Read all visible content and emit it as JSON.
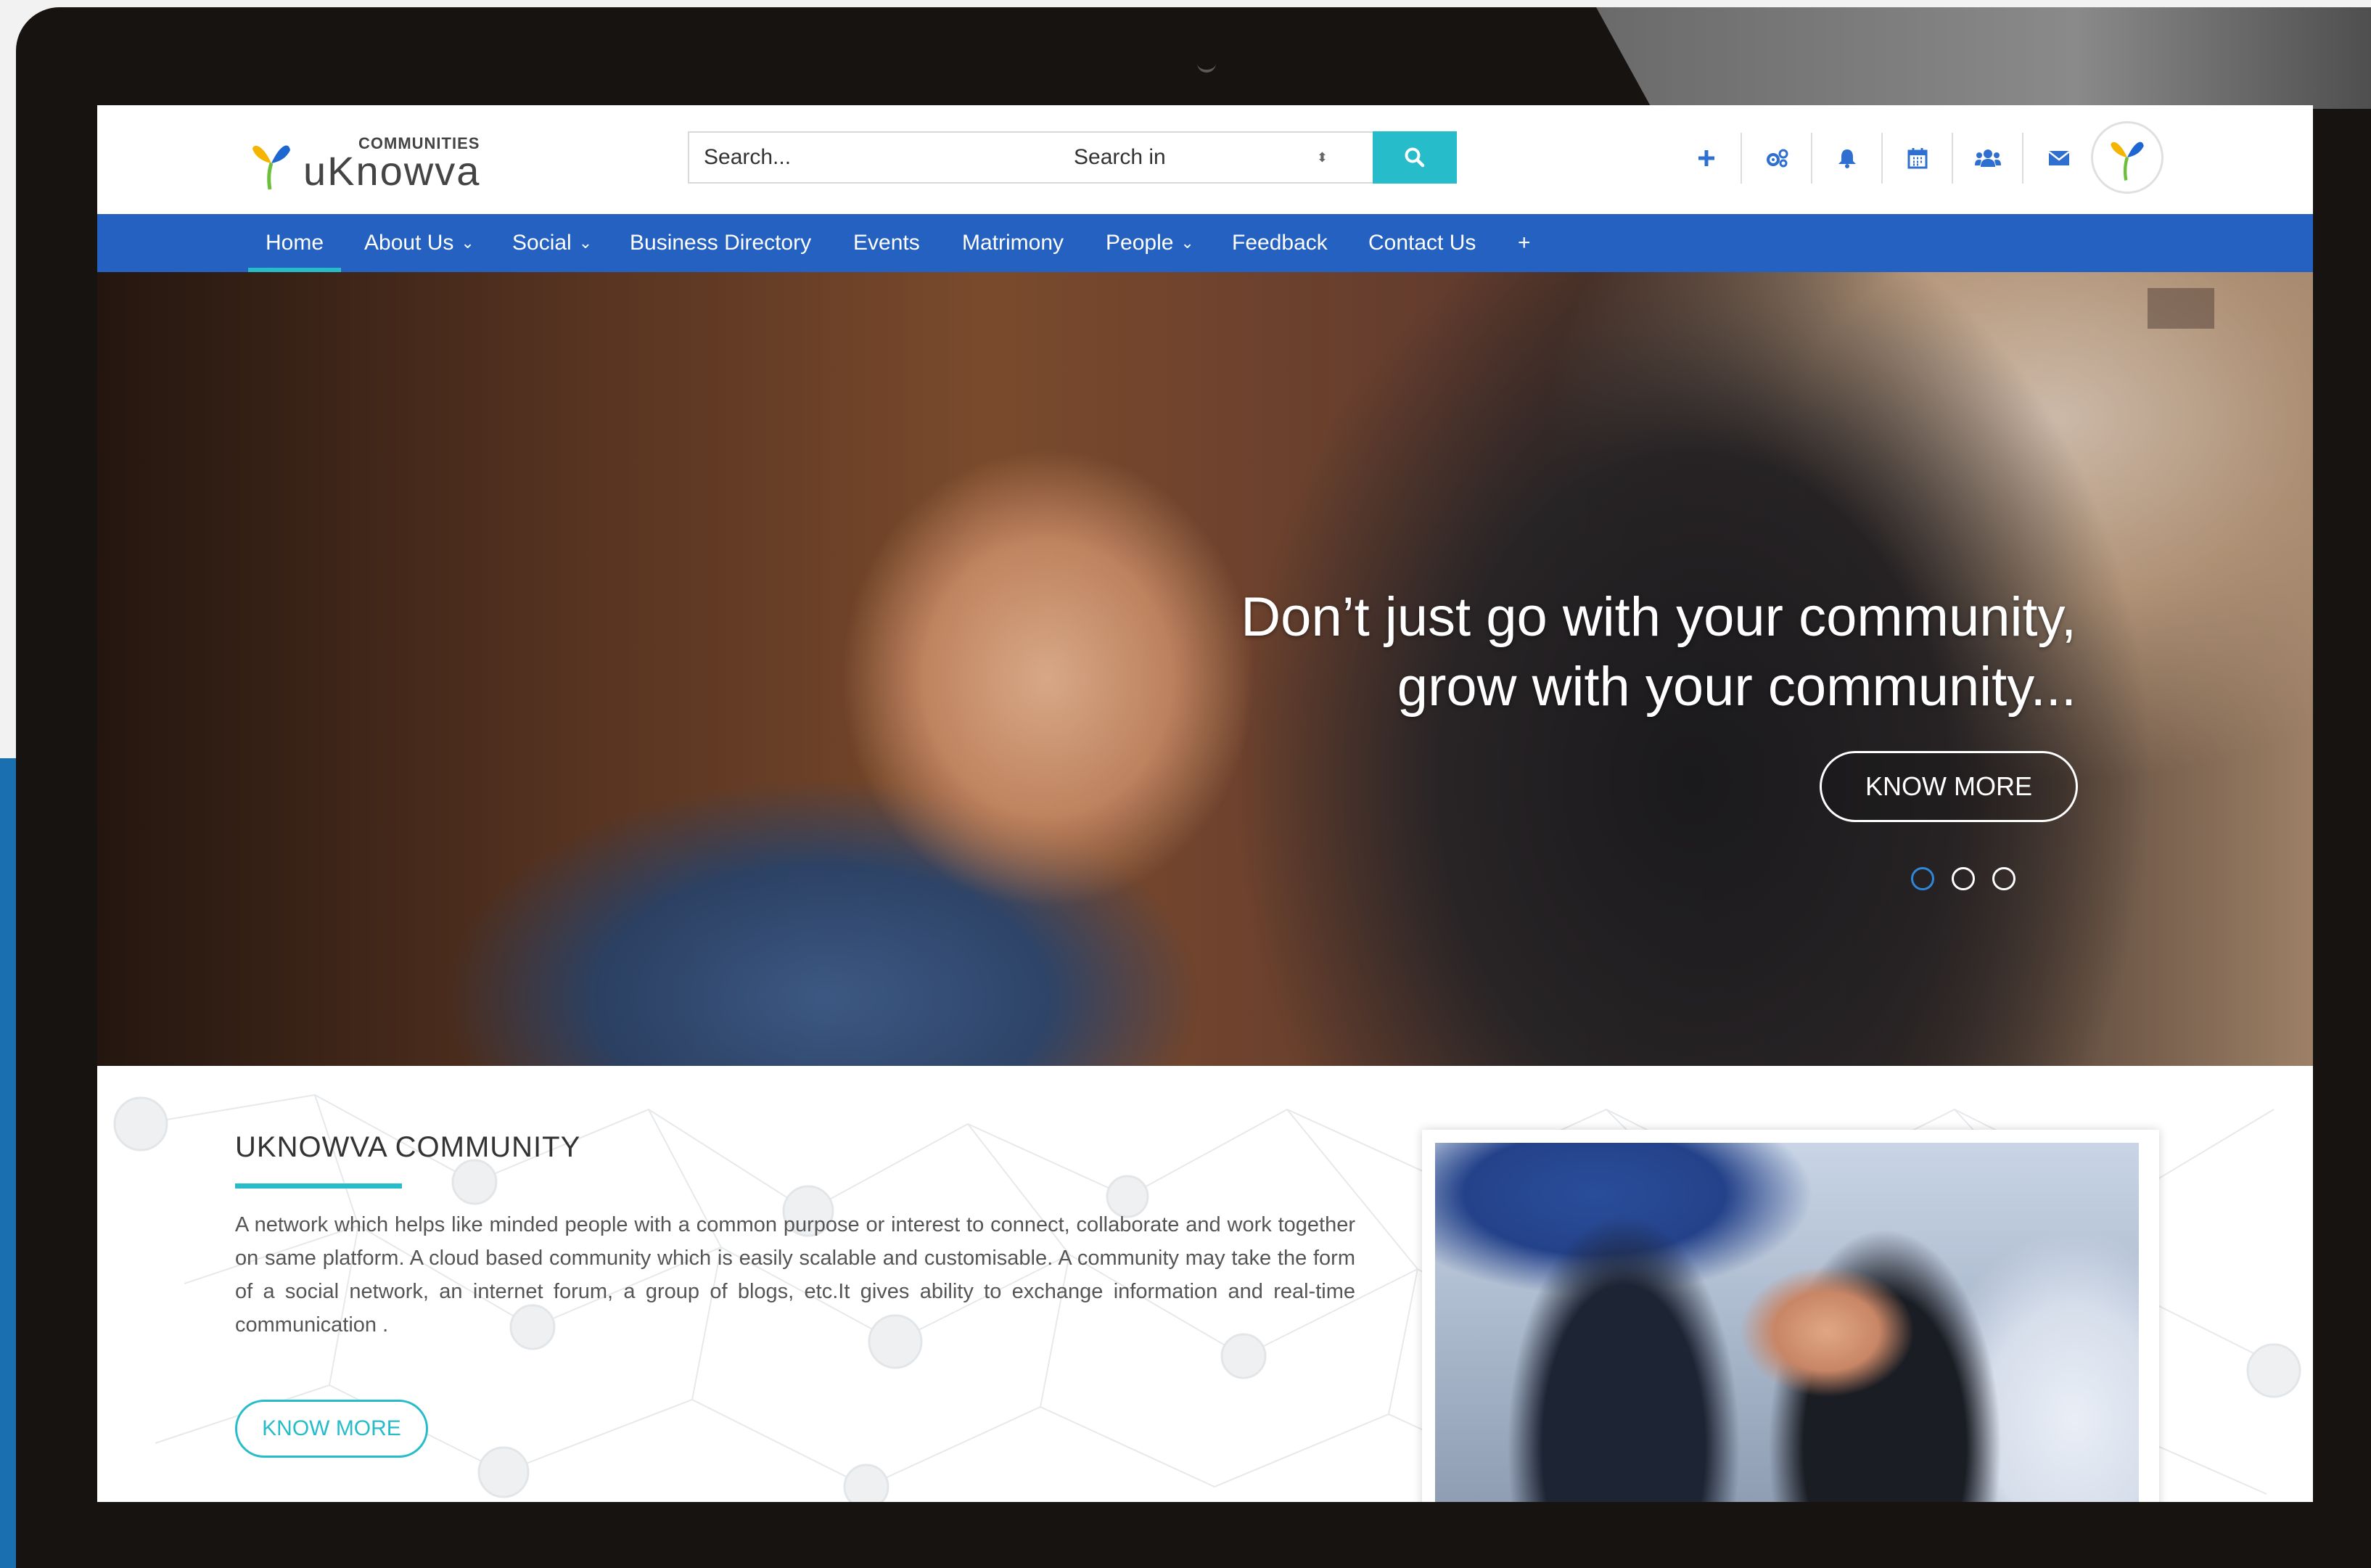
{
  "logo": {
    "small_text": "COMMUNITIES",
    "main_text": "uKnowva"
  },
  "search": {
    "placeholder": "Search...",
    "search_in_label": "Search in",
    "search_in_caret": "⬍"
  },
  "toolbar_icons": [
    "plus-icon",
    "cogs-icon",
    "bell-icon",
    "calendar-icon",
    "users-icon",
    "envelope-icon"
  ],
  "nav": {
    "items": [
      {
        "label": "Home",
        "has_dropdown": false,
        "active": true
      },
      {
        "label": "About Us",
        "has_dropdown": true
      },
      {
        "label": "Social",
        "has_dropdown": true
      },
      {
        "label": "Business Directory",
        "has_dropdown": false
      },
      {
        "label": "Events",
        "has_dropdown": false
      },
      {
        "label": "Matrimony",
        "has_dropdown": false
      },
      {
        "label": "People",
        "has_dropdown": true
      },
      {
        "label": "Feedback",
        "has_dropdown": false
      },
      {
        "label": "Contact Us",
        "has_dropdown": false
      },
      {
        "label": "+",
        "has_dropdown": false
      }
    ],
    "chevron": "⌄"
  },
  "hero": {
    "line1": "Don’t just go with your community,",
    "line2": "grow with your community...",
    "button_label": "KNOW MORE",
    "slides": 3,
    "active_slide": 1
  },
  "about": {
    "title": "UKNOWVA COMMUNITY",
    "text": "A network which helps like minded people with a common purpose or interest to connect, collaborate and work together on same platform. A cloud based community which is easily scalable and customisable. A community may take the form of a social network, an internet forum, a group of blogs, etc.It gives ability to exchange information and real-time communication .",
    "button_label": "KNOW MORE"
  },
  "colors": {
    "nav_blue": "#2461c0",
    "accent_teal": "#26bcc9",
    "icon_blue": "#2f6fd0",
    "active_dot": "#2f87d9"
  }
}
